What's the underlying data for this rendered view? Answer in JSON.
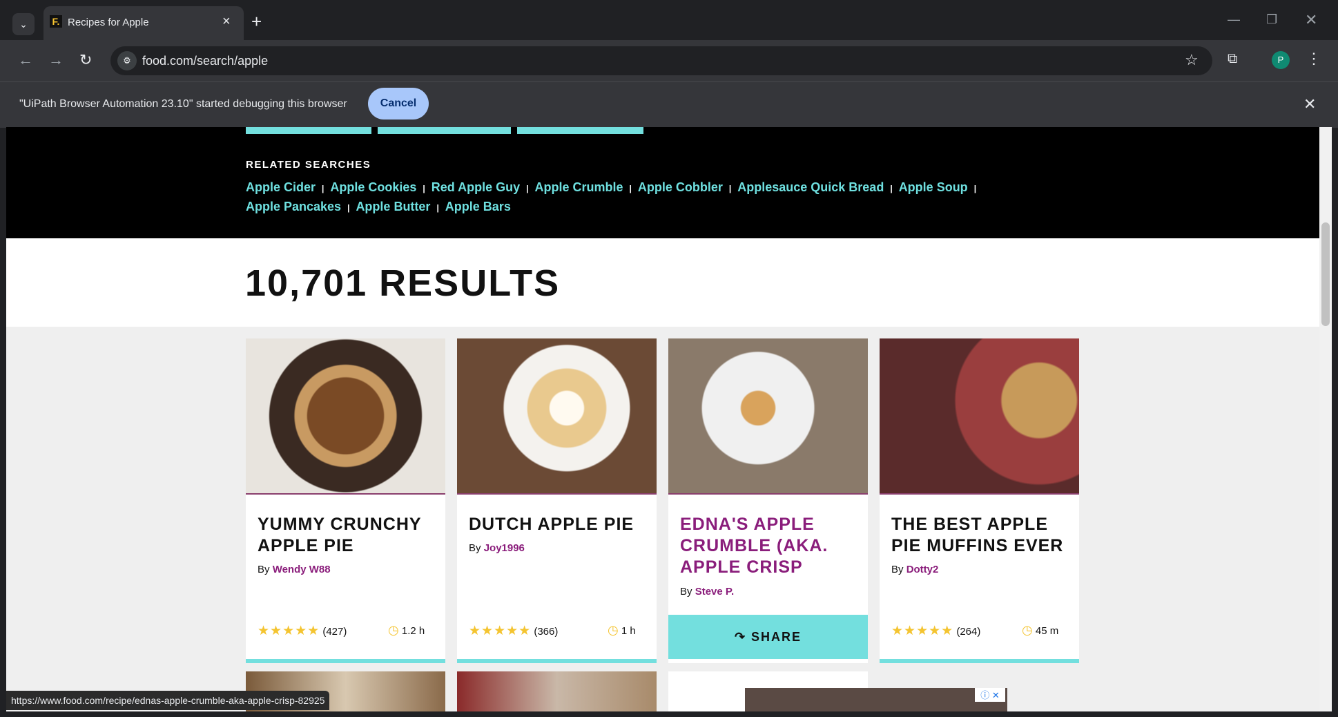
{
  "browser": {
    "tab_title": "Recipes for Apple",
    "url": "food.com/search/apple",
    "profile_initial": "P",
    "debug_message": "\"UiPath Browser Automation 23.10\" started debugging this browser",
    "debug_cancel": "Cancel",
    "status_url": "https://www.food.com/recipe/ednas-apple-crumble-aka-apple-crisp-82925"
  },
  "related": {
    "title": "RELATED SEARCHES",
    "items": [
      "Apple Cider",
      "Apple Cookies",
      "Red Apple Guy",
      "Apple Crumble",
      "Apple Cobbler",
      "Applesauce Quick Bread",
      "Apple Soup",
      "Apple Pancakes",
      "Apple Butter",
      "Apple Bars"
    ]
  },
  "results": {
    "count_label": "10,701 RESULTS"
  },
  "cards": [
    {
      "title": "YUMMY CRUNCHY APPLE PIE",
      "by": "By",
      "author": "Wendy W88",
      "stars": "★★★★★",
      "reviews": "(427)",
      "time": "1.2 h",
      "share": ""
    },
    {
      "title": "DUTCH APPLE PIE",
      "by": "By",
      "author": "Joy1996",
      "stars": "★★★★★",
      "reviews": "(366)",
      "time": "1 h",
      "share": ""
    },
    {
      "title": "EDNA'S APPLE CRUMBLE (AKA. APPLE CRISP",
      "by": "By",
      "author": "Steve P.",
      "stars": "",
      "reviews": "",
      "time": "",
      "share": "SHARE"
    },
    {
      "title": "THE BEST APPLE PIE MUFFINS EVER",
      "by": "By",
      "author": "Dotty2",
      "stars": "★★★★★",
      "reviews": "(264)",
      "time": "45 m",
      "share": ""
    }
  ],
  "icons": {
    "tab_list": "chevron-down-icon",
    "favicon": "food-logo-icon",
    "close": "close-icon",
    "new_tab": "plus-icon",
    "back": "back-arrow-icon",
    "forward": "forward-arrow-icon",
    "reload": "reload-icon",
    "site_info": "site-info-icon",
    "bookmark": "star-icon",
    "extensions": "puzzle-icon",
    "menu": "kebab-menu-icon",
    "clock": "clock-icon",
    "share": "share-arrow-icon"
  },
  "colors": {
    "accent": "#73dfde",
    "visited": "#8a1d7b",
    "star": "#f4c430"
  }
}
